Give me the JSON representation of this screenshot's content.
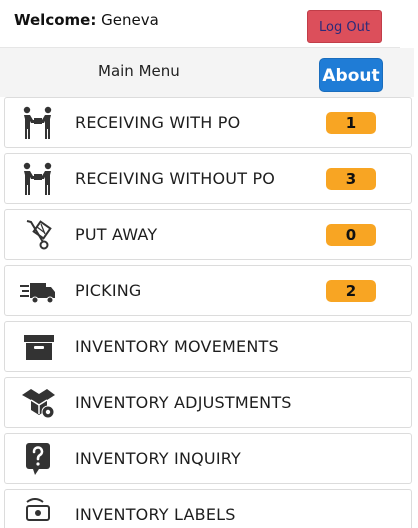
{
  "header": {
    "welcome_prefix": "Welcome:",
    "user_name": "Geneva",
    "logout_label": "Log Out"
  },
  "menu": {
    "title": "Main Menu",
    "about_label": "About"
  },
  "items": [
    {
      "label": "RECEIVING WITH PO",
      "count": "1",
      "icon": "handshake-icon"
    },
    {
      "label": "RECEIVING WITHOUT PO",
      "count": "3",
      "icon": "handshake-icon"
    },
    {
      "label": "PUT AWAY",
      "count": "0",
      "icon": "hand-truck-icon"
    },
    {
      "label": "PICKING",
      "count": "2",
      "icon": "delivery-truck-icon"
    },
    {
      "label": "INVENTORY MOVEMENTS",
      "icon": "archive-box-icon"
    },
    {
      "label": "INVENTORY ADJUSTMENTS",
      "icon": "box-gear-icon"
    },
    {
      "label": "INVENTORY INQUIRY",
      "icon": "question-icon"
    },
    {
      "label": "INVENTORY LABELS",
      "icon": "label-printer-icon"
    }
  ],
  "colors": {
    "logout_bg": "#dc4f5b",
    "about_bg": "#1f7cd6",
    "badge_bg": "#f8a523"
  }
}
